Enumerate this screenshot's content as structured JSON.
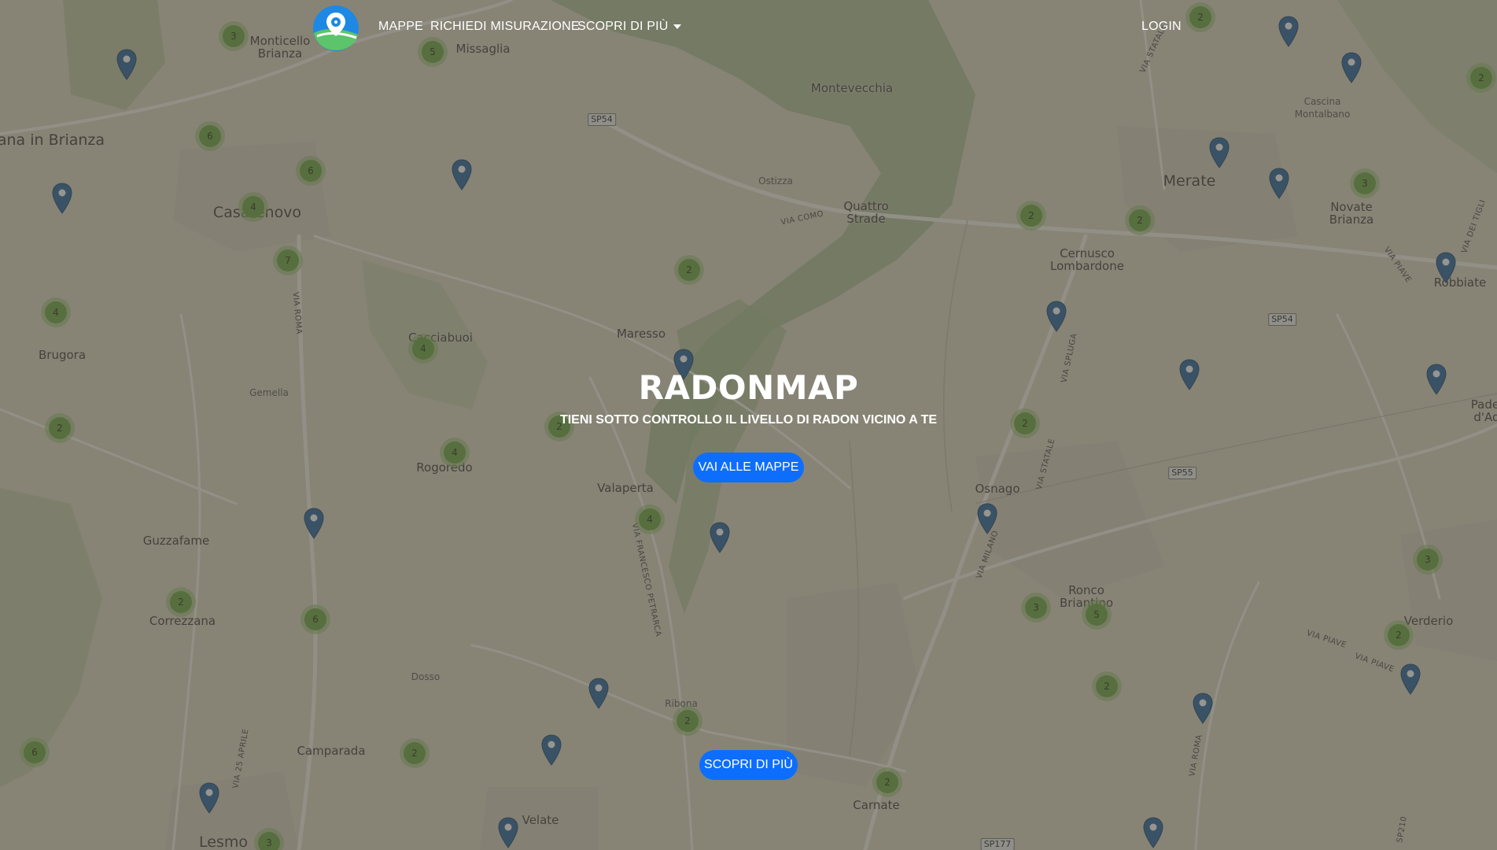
{
  "nav": {
    "logo_icon": "radon-map-logo",
    "links": [
      "MAPPE",
      "RICHIEDI MISURAZIONE",
      "SCOPRI DI PIÙ"
    ],
    "login": "LOGIN"
  },
  "hero": {
    "title": "RADONMAP",
    "subtitle": "TIENI SOTTO CONTROLLO IL LIVELLO DI RADON VICINO A TE",
    "cta_maps": "VAI ALLE MAPPE",
    "cta_more": "SCOPRI DI PIÙ"
  },
  "places": [
    "Monticello\nBrianza",
    "Missaglia",
    "Montevecchia",
    "Cascina\nMontalbano",
    "sana in Brianza",
    "Merate",
    "Ostizza",
    "Quattro\nStrade",
    "Novate\nBrianza",
    "Casatenovo",
    "Cernusco\nLombardone",
    "Robbiate",
    "Maresso",
    "Brugora",
    "Cacciabuoi",
    "Gemella",
    "Padel\nd'Ad",
    "Rogoredo",
    "Valaperta",
    "Osnago",
    "Guzzafame",
    "Correzzana",
    "Ronco\nBriantino",
    "Verderio",
    "Dosso",
    "Ribona",
    "Camparada",
    "Carnate",
    "Velate",
    "Lesmo"
  ],
  "roads": [
    "SP54",
    "VIA COMO",
    "VIA ROMA",
    "VIA SPLUGA",
    "SP54",
    "SP55",
    "VIA STATALE",
    "VIA FRANCESCO PETRARCA",
    "VIA MILANO",
    "VIA PIAVE",
    "VIA ROMA",
    "VIA 25 APRILE",
    "SP177",
    "VIA STATALE",
    "VIA DEI TIGLI",
    "VIA PIAVE",
    "VIA PIAVE",
    "SP210"
  ],
  "clusters": [
    "3",
    "5",
    "2",
    "2",
    "6",
    "6",
    "4",
    "3",
    "7",
    "2",
    "2",
    "2",
    "4",
    "4",
    "2",
    "4",
    "2",
    "2",
    "4",
    "3",
    "5",
    "3",
    "2",
    "6",
    "2",
    "2",
    "2",
    "6",
    "2",
    "2",
    "3"
  ],
  "pin_icon": "map-marker-icon",
  "colors": {
    "button": "#0d6efd",
    "cluster": "#64a03c",
    "marker": "#1f5f9e"
  }
}
